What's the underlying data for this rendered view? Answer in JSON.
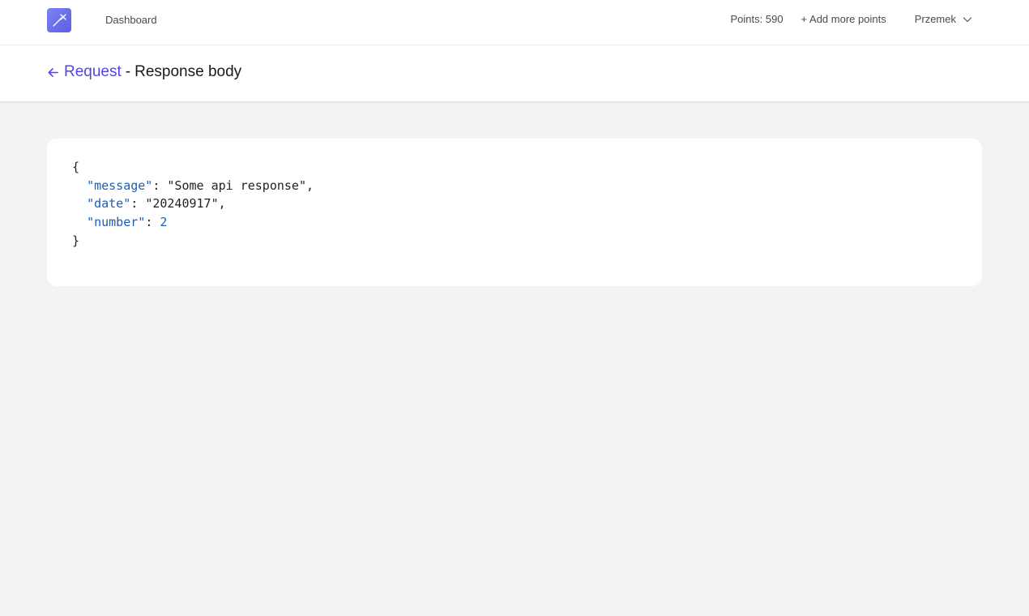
{
  "nav": {
    "dashboard_label": "Dashboard",
    "points_label": "Points: 590",
    "add_points_label": "+ Add more points",
    "user_name": "Przemek",
    "logo_icon": "logo-icon",
    "chevron_icon": "chevron-down-icon"
  },
  "header": {
    "back_label": "Request",
    "separator": "-",
    "title": "Response body",
    "back_icon": "arrow-left-icon"
  },
  "response": {
    "open_brace": "{",
    "close_brace": "}",
    "fields": [
      {
        "key": "\"message\"",
        "value": "\"Some api response\"",
        "value_type": "string",
        "trailing": ","
      },
      {
        "key": "\"date\"",
        "value": "\"20240917\"",
        "value_type": "string",
        "trailing": ","
      },
      {
        "key": "\"number\"",
        "value": "2",
        "value_type": "number",
        "trailing": ""
      }
    ]
  },
  "colors": {
    "accent": "#4f46e5",
    "json_key": "#1a5fb4",
    "background": "#f3f3f3"
  }
}
